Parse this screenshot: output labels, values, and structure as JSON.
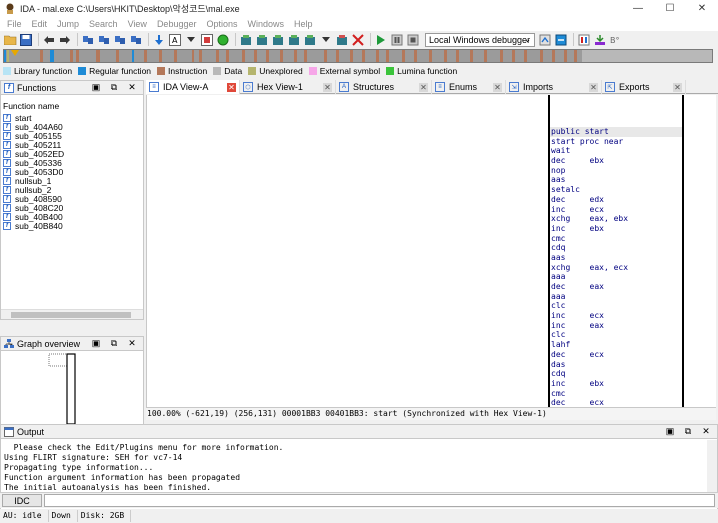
{
  "window": {
    "title": "IDA - mal.exe C:\\Users\\HKIT\\Desktop\\악성코드\\mal.exe",
    "controls": [
      "—",
      "☐",
      "✕"
    ]
  },
  "menu": [
    "File",
    "Edit",
    "Jump",
    "Search",
    "View",
    "Debugger",
    "Options",
    "Windows",
    "Help"
  ],
  "toolbar": {
    "debugger_select": "Local Windows debugger"
  },
  "legend": [
    {
      "label": "Library function",
      "color": "#b7e4f5"
    },
    {
      "label": "Regular function",
      "color": "#1e8bd6"
    },
    {
      "label": "Instruction",
      "color": "#b4785a"
    },
    {
      "label": "Data",
      "color": "#b8b8b8"
    },
    {
      "label": "Unexplored",
      "color": "#b5b56e"
    },
    {
      "label": "External symbol",
      "color": "#f6a6e8"
    },
    {
      "label": "Lumina function",
      "color": "#3bc43b"
    }
  ],
  "functions_panel": {
    "title": "Functions",
    "column": "Function name",
    "items": [
      "start",
      "sub_404A60",
      "sub_405155",
      "sub_405211",
      "sub_4052ED",
      "sub_405336",
      "sub_4053D0",
      "nullsub_1",
      "nullsub_2",
      "sub_408590",
      "sub_408C20",
      "sub_40B400",
      "sub_40B840"
    ]
  },
  "graph_panel": {
    "title": "Graph overview"
  },
  "tabs": [
    {
      "label": "IDA View-A",
      "icon": "ida-view-icon",
      "active": true
    },
    {
      "label": "Hex View-1",
      "icon": "hex-view-icon",
      "active": false
    },
    {
      "label": "Structures",
      "icon": "structures-icon",
      "active": false
    },
    {
      "label": "Enums",
      "icon": "enums-icon",
      "active": false
    },
    {
      "label": "Imports",
      "icon": "imports-icon",
      "active": false
    },
    {
      "label": "Exports",
      "icon": "exports-icon",
      "active": false
    }
  ],
  "disasm": [
    "public start",
    "start proc near",
    "wait",
    "dec     ebx",
    "nop",
    "aas",
    "setalc",
    "dec     edx",
    "inc     ecx",
    "xchg    eax, ebx",
    "inc     ebx",
    "cmc",
    "cdq",
    "aas",
    "xchg    eax, ecx",
    "aaa",
    "dec     eax",
    "aaa",
    "clc",
    "inc     ecx",
    "inc     eax",
    "clc",
    "lahf",
    "dec     ecx",
    "das",
    "cdq",
    "inc     ebx",
    "cmc",
    "dec     ecx"
  ],
  "status_line": "100.00% (-621,19) (256,131) 00001BB3 00401BB3: start (Synchronized with Hex View-1)",
  "output_panel": {
    "title": "Output",
    "lines": [
      "  Please check the Edit/Plugins menu for more information.",
      "Using FLIRT signature: SEH for vc7-14",
      "Propagating type information...",
      "Function argument information has been propagated",
      "The initial autoanalysis has been finished."
    ]
  },
  "idc": {
    "button": "IDC",
    "input": ""
  },
  "statusbar": {
    "au": "AU:  idle",
    "dir": "Down",
    "disk": "Disk: 2GB"
  }
}
